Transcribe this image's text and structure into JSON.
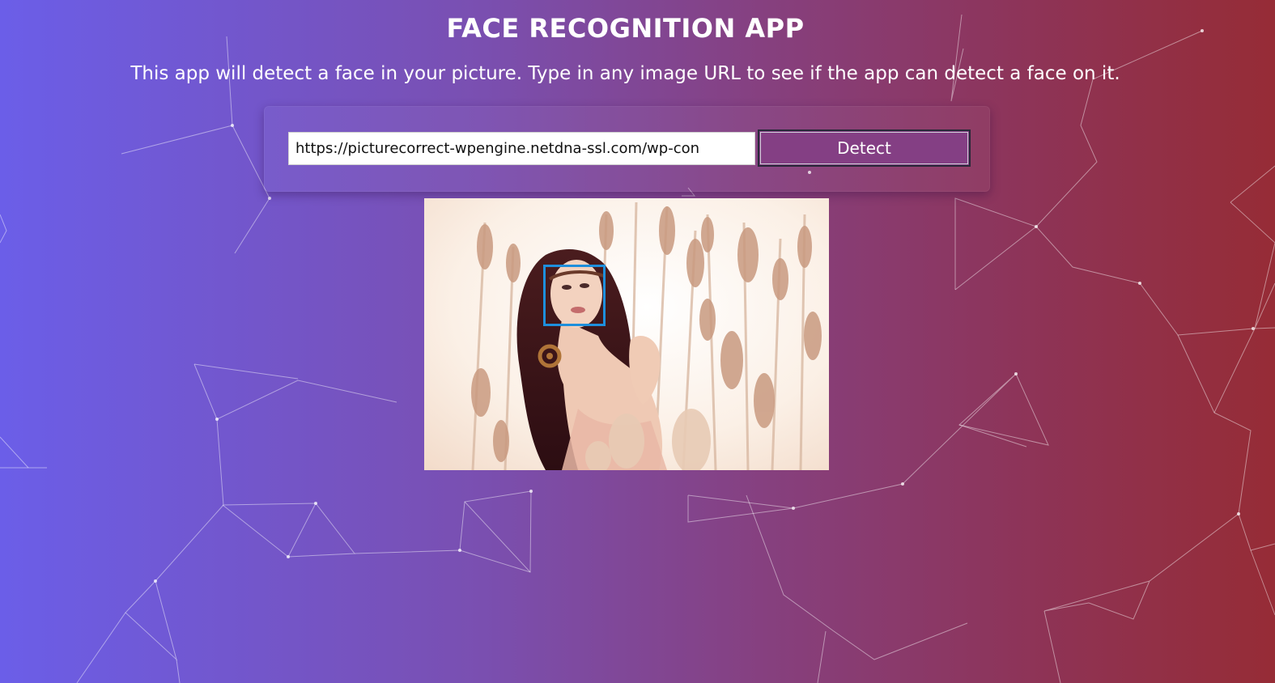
{
  "app": {
    "title": "FACE RECOGNITION APP",
    "description": "This app will detect a face in your picture. Type in any image URL to see if the app can detect a face on it."
  },
  "form": {
    "url_value": "https://picturecorrect-wpengine.netdna-ssl.com/wp-con",
    "detect_label": "Detect"
  },
  "colors": {
    "gradient_start": "#6b5ee8",
    "gradient_end": "#962c36",
    "button_bg": "#843f84",
    "face_box": "#1e8fdc"
  },
  "result": {
    "face_detected": true
  }
}
